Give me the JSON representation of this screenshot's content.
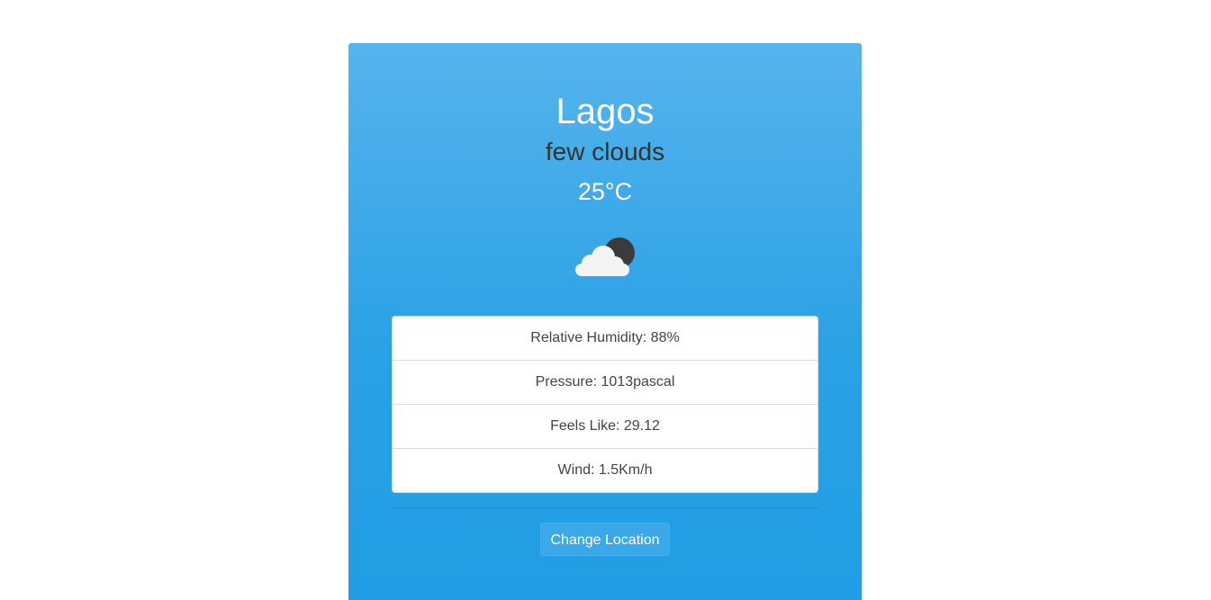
{
  "weather": {
    "city": "Lagos",
    "description": "few clouds",
    "temperature": "25°C",
    "icon": "cloud-night-icon"
  },
  "details": [
    {
      "label": "Relative Humidity: 88%"
    },
    {
      "label": "Pressure: 1013pascal"
    },
    {
      "label": "Feels Like: 29.12"
    },
    {
      "label": "Wind: 1.5Km/h"
    }
  ],
  "actions": {
    "change_location_label": "Change Location"
  },
  "colors": {
    "card_top": "#55b4ec",
    "card_bottom": "#209de5",
    "button": "#3aa8e9"
  }
}
